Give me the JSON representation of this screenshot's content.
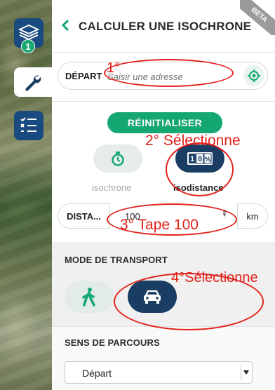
{
  "panel": {
    "title": "CALCULER UNE ISOCHRONE",
    "beta_label": "BETA",
    "depart": {
      "label": "DÉPART",
      "placeholder": "Saisir une adresse"
    },
    "reset_label": "RÉINITIALISER",
    "modes": [
      {
        "label": "isochrone",
        "selected": false,
        "icon": "stopwatch-icon"
      },
      {
        "label": "isodistance",
        "selected": true,
        "icon": "odometer-icon"
      }
    ],
    "distance": {
      "label": "DISTA...",
      "value": "100",
      "unit": "km"
    },
    "transport": {
      "title": "MODE DE TRANSPORT",
      "options": [
        {
          "icon": "pedestrian-icon",
          "selected": false
        },
        {
          "icon": "car-icon",
          "selected": true
        }
      ]
    },
    "direction": {
      "title": "SENS DE PARCOURS",
      "selected": "Départ"
    }
  },
  "toolbar": {
    "layers_badge": "1"
  },
  "annotations": {
    "step1": "1°",
    "step2": "2° Sélectionne",
    "step3": "3° Tape 100",
    "step4": "4°Sélectionne"
  },
  "colors": {
    "accent_green": "#15a772",
    "navy": "#1a3d63",
    "annotation_red": "#e2221b"
  }
}
